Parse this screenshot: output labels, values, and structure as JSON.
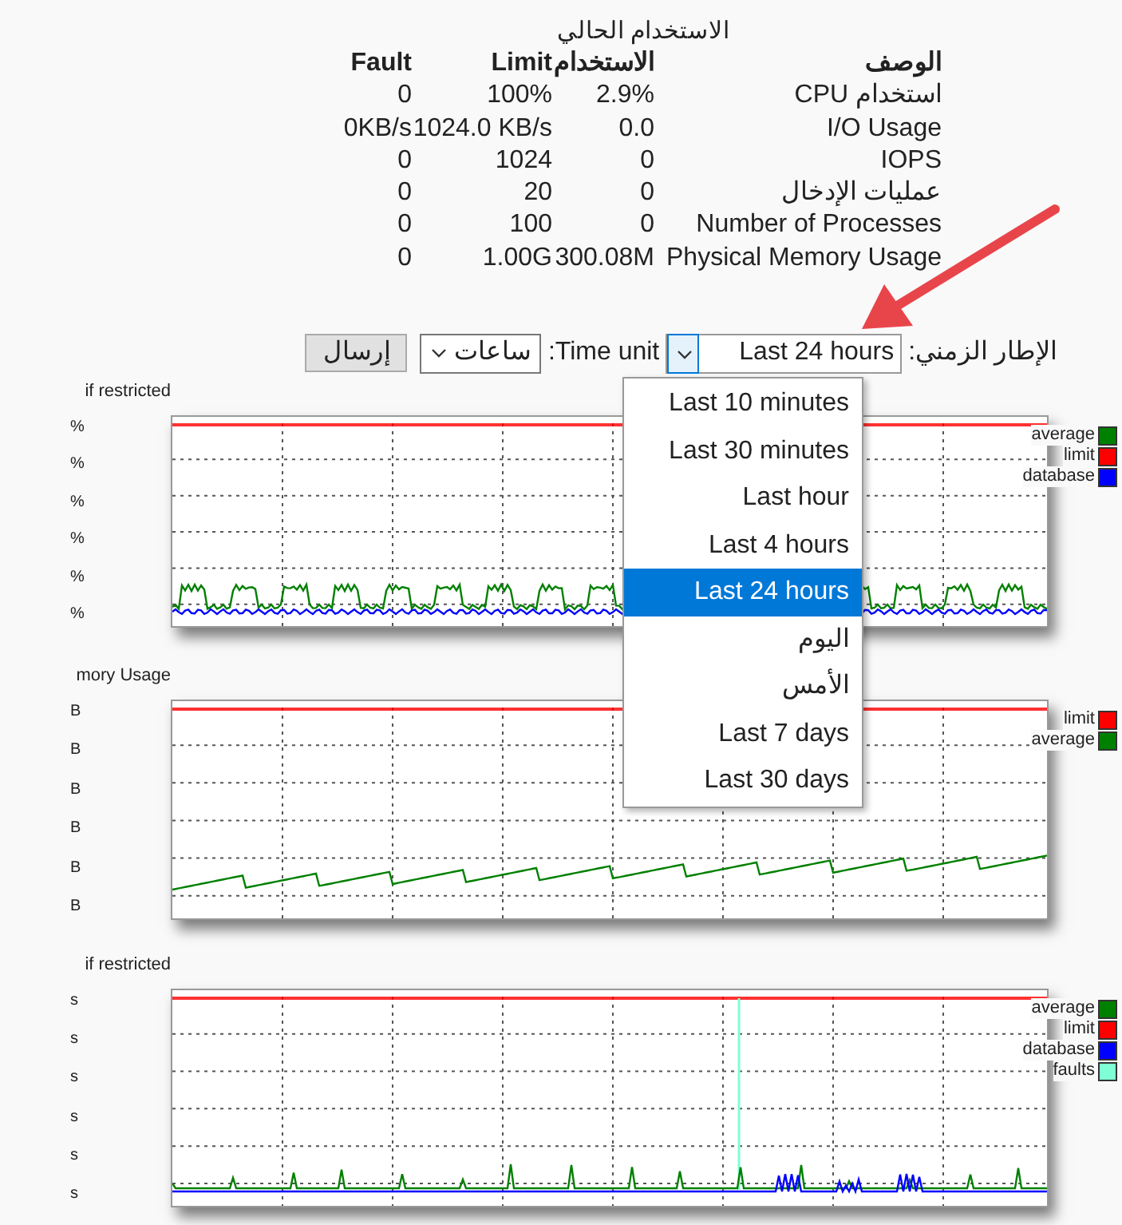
{
  "summary": {
    "title": "الاستخدام الحالي",
    "columns": [
      "Fault",
      "Limit",
      "الاستخدام",
      "الوصف"
    ],
    "rows": [
      [
        "0",
        "100%",
        "2.9%",
        "استخدام CPU"
      ],
      [
        "0KB/s",
        "1024.0 KB/s",
        "0.0",
        "I/O Usage"
      ],
      [
        "0",
        "1024",
        "0",
        "IOPS"
      ],
      [
        "0",
        "20",
        "0",
        "عمليات الإدخال"
      ],
      [
        "0",
        "100",
        "0",
        "Number of Processes"
      ],
      [
        "0",
        "1.00G",
        "300.08M",
        "Physical Memory Usage"
      ]
    ]
  },
  "controls": {
    "timeframe_label": "الإطار الزمني:",
    "timeframe_value": "Last 24 hours",
    "time_unit_label": "Time unit:",
    "time_unit_value": "ساعات",
    "submit": "إرسال"
  },
  "timeframe_menu": [
    {
      "label": "Last 10 minutes",
      "selected": false
    },
    {
      "label": "Last 30 minutes",
      "selected": false
    },
    {
      "label": "Last hour",
      "selected": false
    },
    {
      "label": "Last 4 hours",
      "selected": false
    },
    {
      "label": "Last 24 hours",
      "selected": true
    },
    {
      "label": "اليوم",
      "selected": false
    },
    {
      "label": "الأمس",
      "selected": false
    },
    {
      "label": "Last 7 days",
      "selected": false
    },
    {
      "label": "Last 30 days",
      "selected": false
    }
  ],
  "charts": [
    {
      "kind": "cpu",
      "title": "if restricted",
      "y_labels": [
        "%",
        "%",
        "%",
        "%",
        "%",
        "%"
      ],
      "legend": [
        {
          "label": "average",
          "color": "#008000"
        },
        {
          "label": "limit",
          "color": "#ff0000"
        },
        {
          "label": "database",
          "color": "#0000ff"
        }
      ]
    },
    {
      "kind": "memory",
      "title": "mory Usage",
      "y_labels": [
        "B",
        "B",
        "B",
        "B",
        "B",
        "B"
      ],
      "legend": [
        {
          "label": "limit",
          "color": "#ff0000"
        },
        {
          "label": "average",
          "color": "#008000"
        }
      ]
    },
    {
      "kind": "io",
      "title": "if restricted",
      "y_labels": [
        "s",
        "s",
        "s",
        "s",
        "s",
        "s"
      ],
      "legend": [
        {
          "label": "average",
          "color": "#008000"
        },
        {
          "label": "limit",
          "color": "#ff0000"
        },
        {
          "label": "database",
          "color": "#0000ff"
        },
        {
          "label": "faults",
          "color": "#7fffd4"
        }
      ]
    }
  ]
}
